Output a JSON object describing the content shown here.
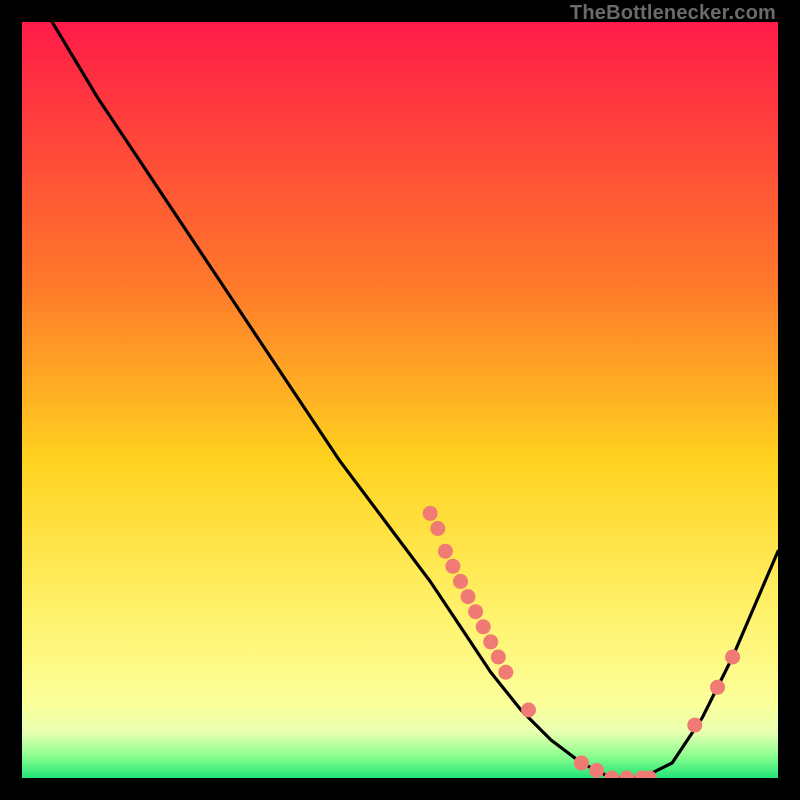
{
  "watermark": "TheBottlenecker.com",
  "colors": {
    "bg": "#000000",
    "grad_top": "#ff1b48",
    "grad_mid1": "#ff7a2a",
    "grad_mid2": "#ffd21f",
    "grad_mid3": "#fff26a",
    "grad_low": "#fcff9a",
    "grad_band1": "#e7ffb0",
    "grad_band2": "#8fff8f",
    "grad_bottom": "#20e576",
    "curve": "#000000",
    "marker": "#ef7b74"
  },
  "chart_data": {
    "type": "line",
    "title": "",
    "xlabel": "",
    "ylabel": "",
    "xlim": [
      0,
      100
    ],
    "ylim": [
      0,
      100
    ],
    "series": [
      {
        "name": "bottleneck-curve",
        "x": [
          4,
          10,
          18,
          26,
          34,
          42,
          48,
          54,
          58,
          62,
          66,
          70,
          74,
          78,
          82,
          86,
          90,
          94,
          100
        ],
        "y": [
          100,
          90,
          78,
          66,
          54,
          42,
          34,
          26,
          20,
          14,
          9,
          5,
          2,
          0,
          0,
          2,
          8,
          16,
          30
        ]
      }
    ],
    "markers": {
      "name": "highlight-points",
      "points": [
        {
          "x": 54,
          "y": 35
        },
        {
          "x": 55,
          "y": 33
        },
        {
          "x": 56,
          "y": 30
        },
        {
          "x": 57,
          "y": 28
        },
        {
          "x": 58,
          "y": 26
        },
        {
          "x": 59,
          "y": 24
        },
        {
          "x": 60,
          "y": 22
        },
        {
          "x": 61,
          "y": 20
        },
        {
          "x": 62,
          "y": 18
        },
        {
          "x": 63,
          "y": 16
        },
        {
          "x": 64,
          "y": 14
        },
        {
          "x": 67,
          "y": 9
        },
        {
          "x": 74,
          "y": 2
        },
        {
          "x": 76,
          "y": 1
        },
        {
          "x": 78,
          "y": 0
        },
        {
          "x": 80,
          "y": 0
        },
        {
          "x": 82,
          "y": 0
        },
        {
          "x": 83,
          "y": 0
        },
        {
          "x": 89,
          "y": 7
        },
        {
          "x": 92,
          "y": 12
        },
        {
          "x": 94,
          "y": 16
        }
      ]
    }
  }
}
